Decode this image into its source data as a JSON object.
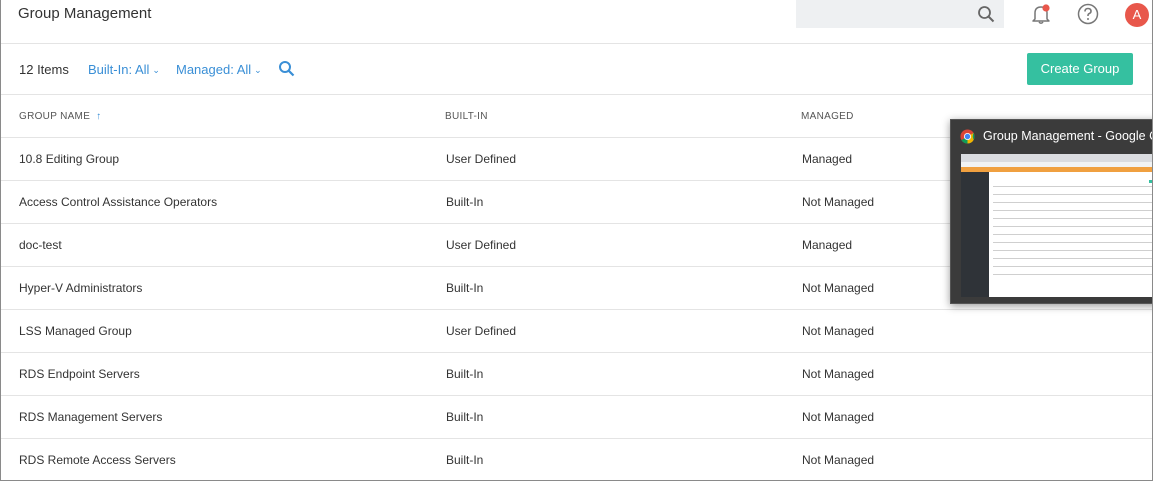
{
  "header": {
    "title": "Group Management",
    "avatar_initial": "A",
    "notification_dot_color": "#e8574b"
  },
  "toolbar": {
    "item_count": "12 Items",
    "filter_builtin": "Built-In: All",
    "filter_managed": "Managed: All",
    "create_button": "Create Group",
    "accent_color": "#3a8fd6",
    "button_color": "#35c0a0"
  },
  "table": {
    "columns": [
      "GROUP NAME",
      "BUILT-IN",
      "MANAGED"
    ],
    "sort_icon": "arrow-up-icon",
    "rows": [
      {
        "name": "10.8 Editing Group",
        "builtin": "User Defined",
        "managed": "Managed"
      },
      {
        "name": "Access Control Assistance Operators",
        "builtin": "Built-In",
        "managed": "Not Managed"
      },
      {
        "name": "doc-test",
        "builtin": "User Defined",
        "managed": "Managed"
      },
      {
        "name": "Hyper-V Administrators",
        "builtin": "Built-In",
        "managed": "Not Managed"
      },
      {
        "name": "LSS Managed Group",
        "builtin": "User Defined",
        "managed": "Not Managed"
      },
      {
        "name": "RDS Endpoint Servers",
        "builtin": "Built-In",
        "managed": "Not Managed"
      },
      {
        "name": "RDS Management Servers",
        "builtin": "Built-In",
        "managed": "Not Managed"
      },
      {
        "name": "RDS Remote Access Servers",
        "builtin": "Built-In",
        "managed": "Not Managed"
      }
    ]
  },
  "preview": {
    "title": "Group Management - Google C..."
  }
}
